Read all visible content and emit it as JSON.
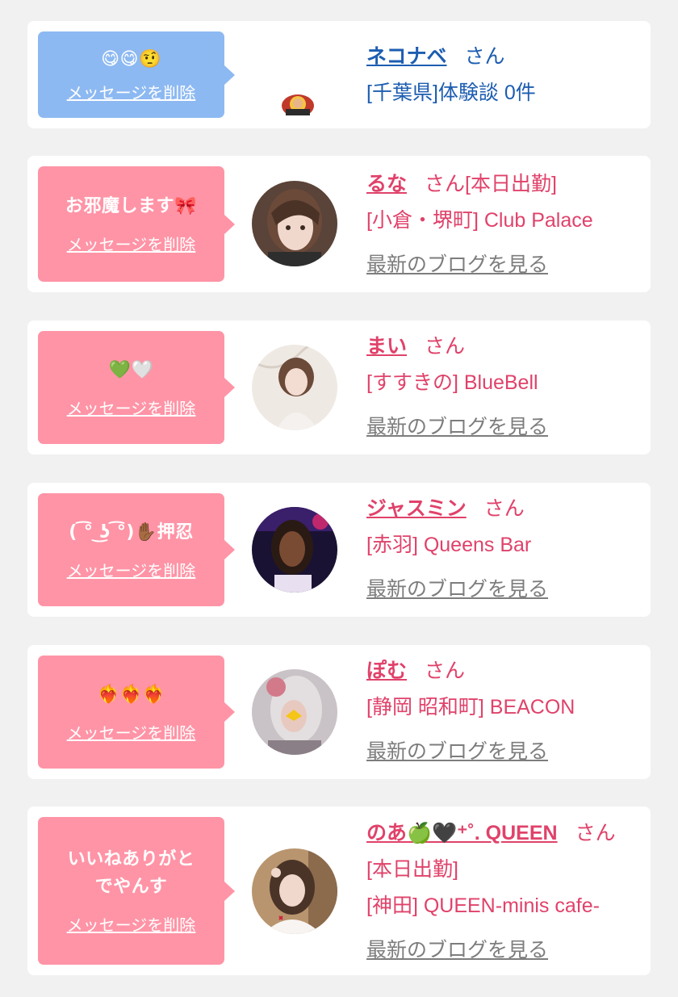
{
  "colors": {
    "pink_bubble": "#ff94a6",
    "blue_bubble": "#8db9f2",
    "pink_text": "#e0426a",
    "blue_text": "#1d5db1",
    "blog_link": "#7d7d7d"
  },
  "delete_label": "メッセージを削除",
  "blog_label": "最新のブログを見る",
  "honorific": "さん",
  "entries": [
    {
      "message": "😋😋🤨",
      "name": "ネコナベ",
      "status": "",
      "info": "[千葉県]体験談 0件",
      "avatar": "small-avatar"
    },
    {
      "message": "お邪魔します🎀",
      "name": "るな",
      "status": "[本日出勤]",
      "info": "[小倉・堺町] Club Palace",
      "avatar": "photo"
    },
    {
      "message": "💚🤍",
      "name": "まい",
      "status": "",
      "info": "[すすきの] BlueBell",
      "avatar": "photo"
    },
    {
      "message": "( ͡° ͜ʖ ͡°)✋🏾押忍",
      "name": "ジャスミン",
      "status": "",
      "info": "[赤羽] Queens Bar",
      "avatar": "photo"
    },
    {
      "message": "❤️‍🔥❤️‍🔥❤️‍🔥",
      "name": "ぽむ",
      "status": "",
      "info": "[静岡 昭和町] BEACON",
      "avatar": "photo"
    },
    {
      "message": "いいねありがとでやんす",
      "name": "のあ🍏🖤⁺˚. QUEEN",
      "status": "[本日出勤]",
      "info": "[神田] QUEEN-minis cafe-",
      "avatar": "photo"
    }
  ]
}
